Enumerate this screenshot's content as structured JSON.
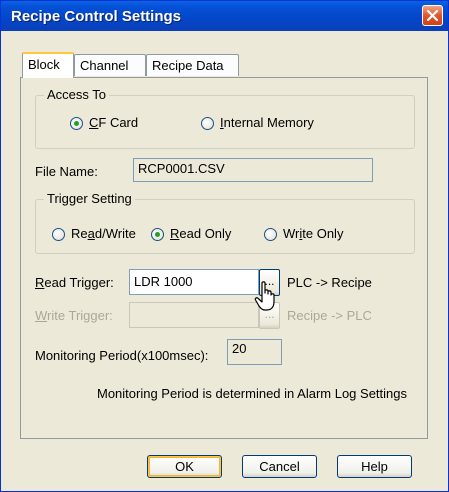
{
  "window": {
    "title": "Recipe Control Settings"
  },
  "tabs": [
    {
      "label": "Block",
      "active": true
    },
    {
      "label": "Channel",
      "active": false
    },
    {
      "label": "Recipe Data",
      "active": false
    }
  ],
  "access": {
    "legend": "Access To",
    "options": [
      {
        "mnemonic": "C",
        "rest": "F Card",
        "checked": true
      },
      {
        "mnemonic": "I",
        "rest": "nternal Memory",
        "checked": false
      }
    ]
  },
  "file": {
    "label": "File Name:",
    "value": "RCP0001.CSV"
  },
  "trigger": {
    "legend": "Trigger Setting",
    "options": [
      {
        "pre": "Re",
        "mnemonic": "a",
        "rest": "d/Write",
        "checked": false
      },
      {
        "pre": "",
        "mnemonic": "R",
        "rest": "ead Only",
        "checked": true
      },
      {
        "pre": "Wr",
        "mnemonic": "i",
        "rest": "te Only",
        "checked": false
      }
    ]
  },
  "read_trigger": {
    "mnemonic": "R",
    "rest": "ead Trigger:",
    "value": "LDR 1000",
    "browse": "...",
    "direction": "PLC -> Recipe"
  },
  "write_trigger": {
    "mnemonic": "W",
    "rest": "rite Trigger:",
    "value": "",
    "browse": "...",
    "direction": "Recipe -> PLC"
  },
  "monitoring": {
    "label": "Monitoring Period(x100msec):",
    "value": "20",
    "note": "Monitoring Period is determined in Alarm Log Settings"
  },
  "buttons": {
    "ok": "OK",
    "cancel": "Cancel",
    "help": "Help"
  },
  "icons": {
    "close": "close-icon",
    "cursor": "mouse-cursor-icon"
  },
  "colors": {
    "titlebar": "#0550d8",
    "close": "#e2552a",
    "dialog": "#ece9d8",
    "tab_highlight": "#ffc83c"
  }
}
